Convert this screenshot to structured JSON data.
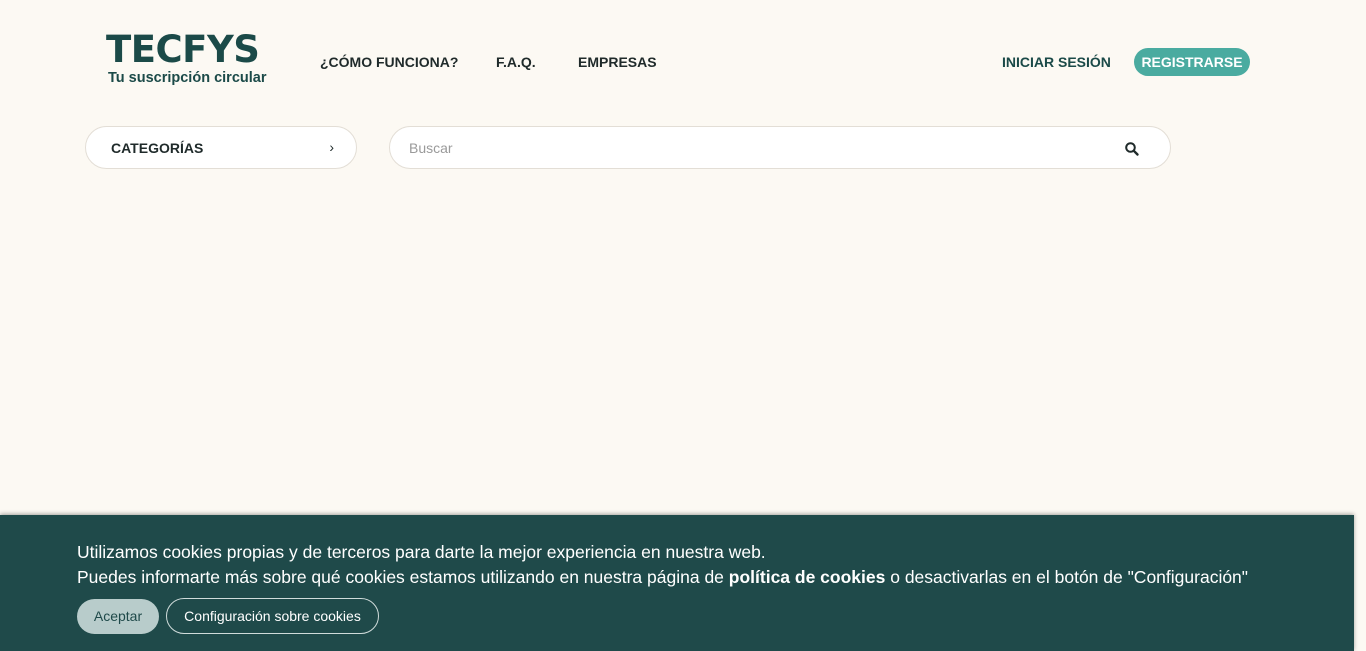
{
  "brand": {
    "logo_text": "TECFYS",
    "tagline": "Tu suscripción circular",
    "color": "#1b4a48"
  },
  "nav": {
    "items": [
      {
        "label": "¿CÓMO FUNCIONA?"
      },
      {
        "label": "F.A.Q."
      },
      {
        "label": "EMPRESAS"
      }
    ],
    "login_label": "INICIAR SESIÓN",
    "register_label": "REGISTRARSE",
    "accent": "#4aaba0"
  },
  "categories": {
    "label": "CATEGORÍAS",
    "chevron": "›"
  },
  "search": {
    "placeholder": "Buscar",
    "value": "",
    "icon": "search-icon"
  },
  "cookie_banner": {
    "line1": "Utilizamos cookies propias y de terceros para darte la mejor experiencia en nuestra web.",
    "line2_prefix": "Puedes informarte más sobre qué cookies estamos utilizando en nuestra página de ",
    "line2_link": "política de cookies",
    "line2_suffix": " o desactivarlas en el botón de \"Configuración\"",
    "accept_label": "Aceptar",
    "config_label": "Configuración sobre cookies",
    "background": "#1f4a4a"
  }
}
